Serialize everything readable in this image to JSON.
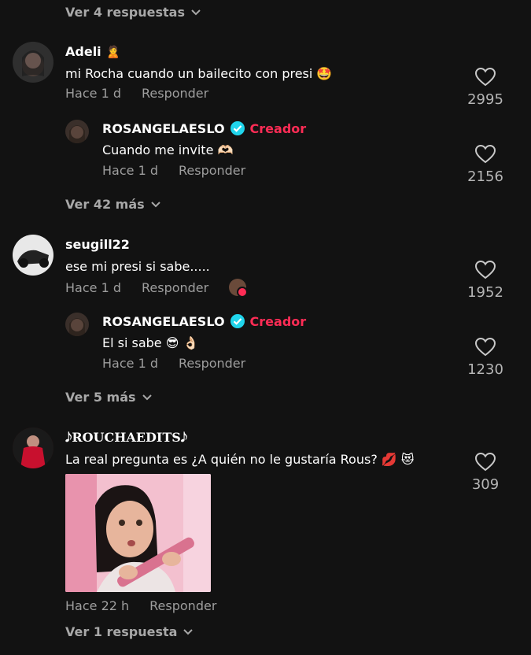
{
  "top_more": {
    "label": "Ver 4 respuestas"
  },
  "comments": [
    {
      "user": "Adeli",
      "user_emoji": "🙎",
      "text": "mi Rocha cuando un bailecito con presi 🤩",
      "time": "Hace 1 d",
      "reply": "Responder",
      "likes": "2995",
      "avatar_color": "#2f2f2f",
      "reply_item": {
        "user": "ROSANGELAESLO",
        "badge": "Creador",
        "text": "Cuando me invite 🫶🏻",
        "time": "Hace 1 d",
        "reply": "Responder",
        "likes": "2156"
      },
      "more": "Ver 42 más"
    },
    {
      "user": "seugill22",
      "text": "ese mi presi si sabe.....",
      "time": "Hace 1 d",
      "reply": "Responder",
      "likes": "1952",
      "avatar_color": "#e8e8e8",
      "reply_item": {
        "user": "ROSANGELAESLO",
        "badge": "Creador",
        "text": "El si sabe 😎 👌🏻",
        "time": "Hace 1 d",
        "reply": "Responder",
        "likes": "1230"
      },
      "more": "Ver 5 más"
    },
    {
      "user": "𝅘𝅥𝅮ROUCHAEDITS𝅘𝅥𝅮",
      "text": "La real pregunta es ¿A quién no le gustaría Rous? 💋 😻",
      "time": "Hace 22 h",
      "reply": "Responder",
      "likes": "309",
      "avatar_color": "#3a0d0d",
      "more": "Ver 1 respuesta"
    }
  ],
  "colors": {
    "background": "#121212",
    "creator": "#fe2c55",
    "verified": "#20d5ec",
    "muted": "#9e9e9e"
  }
}
